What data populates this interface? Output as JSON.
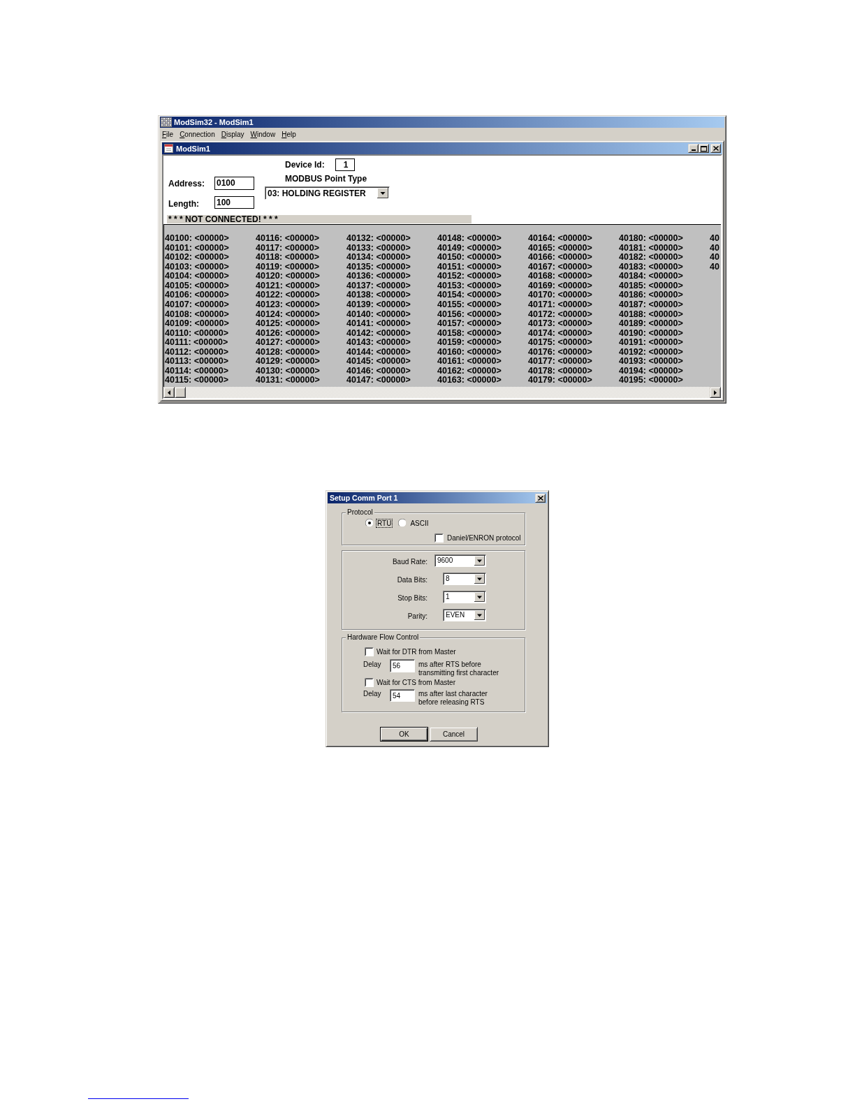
{
  "app_window": {
    "title": "ModSim32 - ModSim1",
    "menu": [
      "File",
      "Connection",
      "Display",
      "Window",
      "Help"
    ]
  },
  "document_window": {
    "title": "ModSim1",
    "device_id": {
      "label": "Device Id:",
      "value": "1"
    },
    "point_type": {
      "label": "MODBUS Point Type",
      "value": "03: HOLDING REGISTER"
    },
    "address": {
      "label": "Address:",
      "value": "0100"
    },
    "length": {
      "label": "Length:",
      "value": "100"
    },
    "status": "* * * NOT CONNECTED! * * *",
    "register_columns": [
      [
        "40100: <00000>",
        "40101: <00000>",
        "40102: <00000>",
        "40103: <00000>",
        "40104: <00000>",
        "40105: <00000>",
        "40106: <00000>",
        "40107: <00000>",
        "40108: <00000>",
        "40109: <00000>",
        "40110: <00000>",
        "40111: <00000>",
        "40112: <00000>",
        "40113: <00000>",
        "40114: <00000>",
        "40115: <00000>"
      ],
      [
        "40116: <00000>",
        "40117: <00000>",
        "40118: <00000>",
        "40119: <00000>",
        "40120: <00000>",
        "40121: <00000>",
        "40122: <00000>",
        "40123: <00000>",
        "40124: <00000>",
        "40125: <00000>",
        "40126: <00000>",
        "40127: <00000>",
        "40128: <00000>",
        "40129: <00000>",
        "40130: <00000>",
        "40131: <00000>"
      ],
      [
        "40132: <00000>",
        "40133: <00000>",
        "40134: <00000>",
        "40135: <00000>",
        "40136: <00000>",
        "40137: <00000>",
        "40138: <00000>",
        "40139: <00000>",
        "40140: <00000>",
        "40141: <00000>",
        "40142: <00000>",
        "40143: <00000>",
        "40144: <00000>",
        "40145: <00000>",
        "40146: <00000>",
        "40147: <00000>"
      ],
      [
        "40148: <00000>",
        "40149: <00000>",
        "40150: <00000>",
        "40151: <00000>",
        "40152: <00000>",
        "40153: <00000>",
        "40154: <00000>",
        "40155: <00000>",
        "40156: <00000>",
        "40157: <00000>",
        "40158: <00000>",
        "40159: <00000>",
        "40160: <00000>",
        "40161: <00000>",
        "40162: <00000>",
        "40163: <00000>"
      ],
      [
        "40164: <00000>",
        "40165: <00000>",
        "40166: <00000>",
        "40167: <00000>",
        "40168: <00000>",
        "40169: <00000>",
        "40170: <00000>",
        "40171: <00000>",
        "40172: <00000>",
        "40173: <00000>",
        "40174: <00000>",
        "40175: <00000>",
        "40176: <00000>",
        "40177: <00000>",
        "40178: <00000>",
        "40179: <00000>"
      ],
      [
        "40180: <00000>",
        "40181: <00000>",
        "40182: <00000>",
        "40183: <00000>",
        "40184: <00000>",
        "40185: <00000>",
        "40186: <00000>",
        "40187: <00000>",
        "40188: <00000>",
        "40189: <00000>",
        "40190: <00000>",
        "40191: <00000>",
        "40192: <00000>",
        "40193: <00000>",
        "40194: <00000>",
        "40195: <00000>"
      ],
      [
        "40",
        "40",
        "40",
        "40"
      ]
    ]
  },
  "dialog": {
    "title": "Setup Comm Port 1",
    "protocol": {
      "legend": "Protocol",
      "options": [
        {
          "label": "RTU",
          "selected": true,
          "focused": true
        },
        {
          "label": "ASCII",
          "selected": false,
          "focused": false
        }
      ],
      "daniel_enron": {
        "label": "Daniel/ENRON protocol",
        "checked": false
      }
    },
    "port_settings": [
      {
        "label": "Baud Rate:",
        "value": "9600"
      },
      {
        "label": "Data Bits:",
        "value": "8"
      },
      {
        "label": "Stop Bits:",
        "value": "1"
      },
      {
        "label": "Parity:",
        "value": "EVEN"
      }
    ],
    "flow_control": {
      "legend": "Hardware Flow Control",
      "items": [
        {
          "label": "Wait for DTR from Master",
          "checked": false,
          "delay_label": "Delay",
          "delay": "56",
          "note": "ms after RTS before transmitting first character"
        },
        {
          "label": "Wait for CTS from Master",
          "checked": false,
          "delay_label": "Delay",
          "delay": "54",
          "note": "ms after last character before releasing RTS"
        }
      ]
    },
    "buttons": [
      {
        "label": "OK",
        "default": true
      },
      {
        "label": "Cancel",
        "default": false
      }
    ]
  }
}
